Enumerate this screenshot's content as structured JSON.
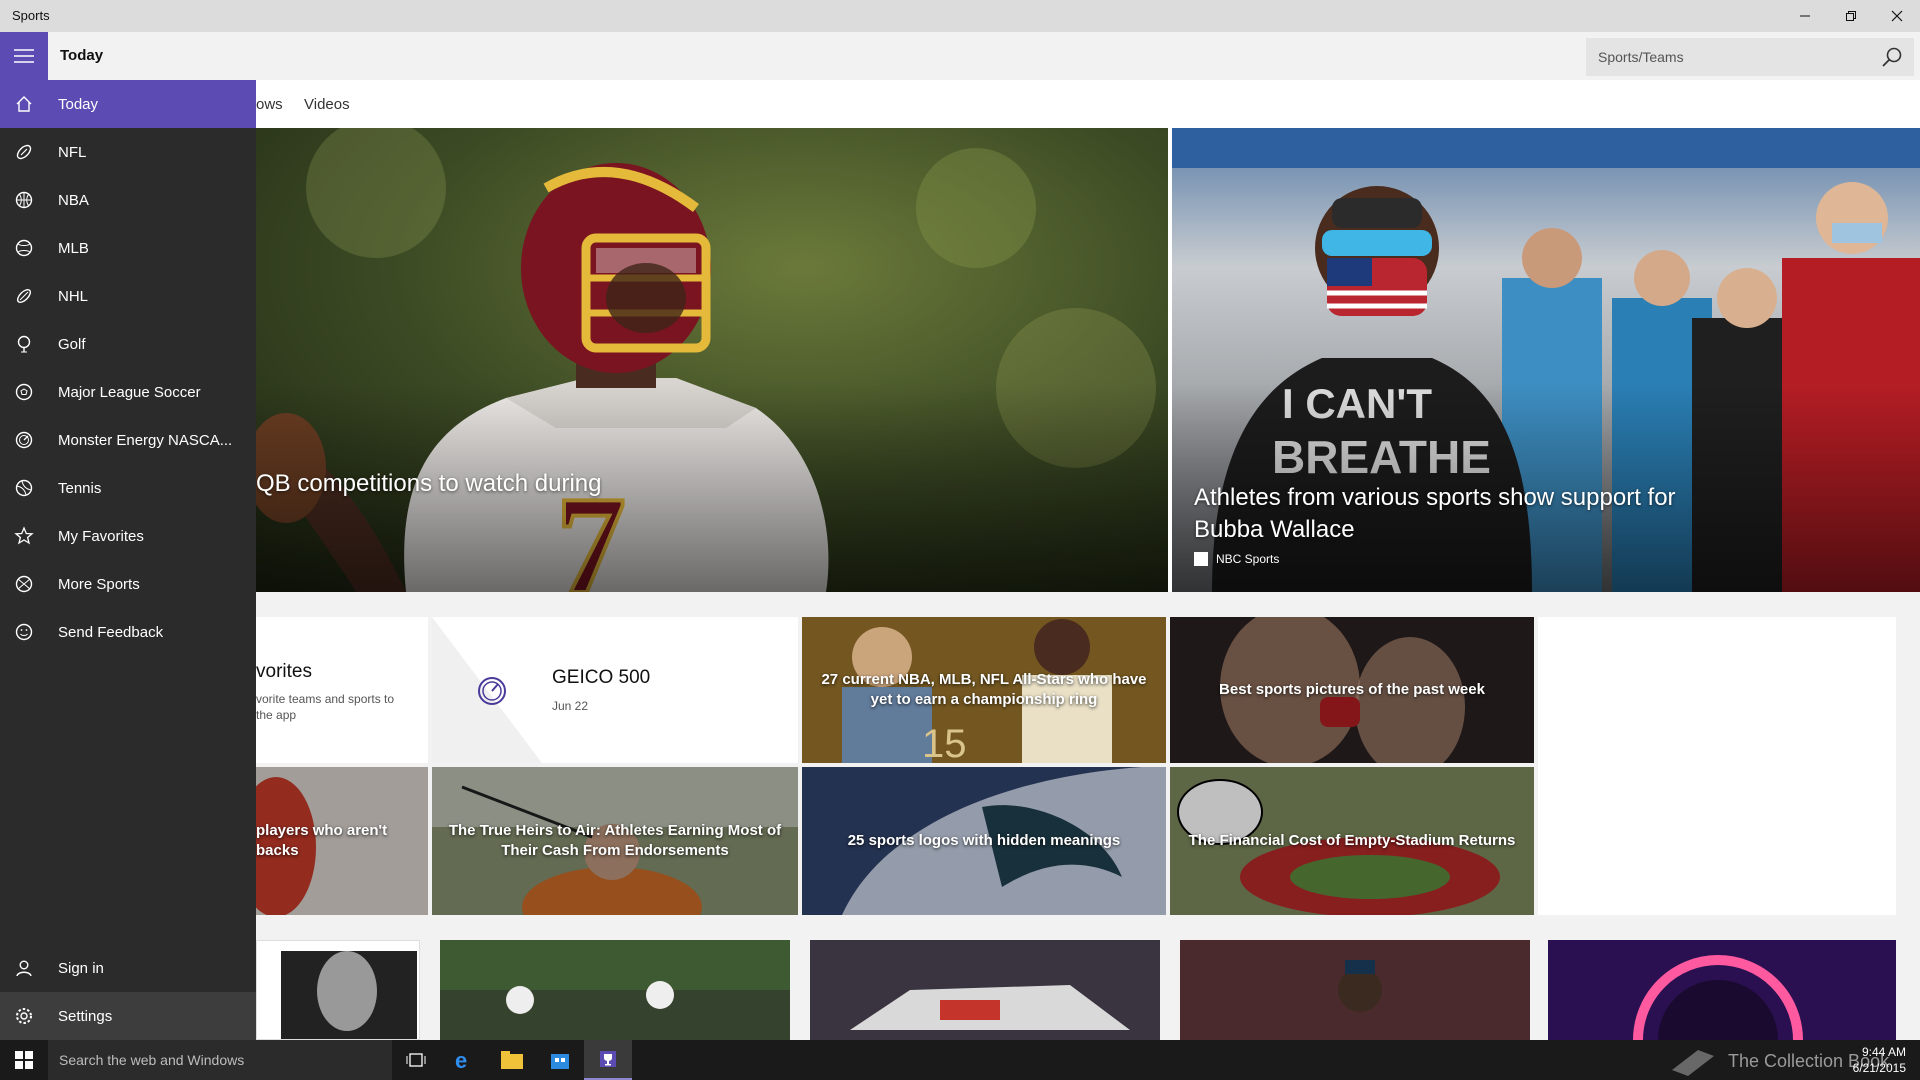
{
  "window": {
    "title": "Sports"
  },
  "header": {
    "page_title": "Today",
    "search_placeholder": "Sports/Teams"
  },
  "tabs": [
    {
      "label": "ows"
    },
    {
      "label": "Videos"
    }
  ],
  "hero": [
    {
      "headline": "QB competitions to watch during"
    },
    {
      "headline": "Athletes from various sports show support for Bubba Wallace",
      "source": "NBC Sports"
    }
  ],
  "favorites_card": {
    "title": "vorites",
    "line1": "vorite teams and sports to",
    "line2": "the app"
  },
  "event_card": {
    "title": "GEICO 500",
    "date": "Jun 22"
  },
  "tiles": [
    {
      "caption": "27 current NBA, MLB, NFL All-Stars who have yet to earn a championship ring"
    },
    {
      "caption": "Best sports pictures of the past week"
    },
    {
      "caption": "players who aren't backs"
    },
    {
      "caption": "The True Heirs to Air: Athletes Earning Most of Their Cash From Endorsements"
    },
    {
      "caption": "25 sports logos with hidden meanings"
    },
    {
      "caption": "The Financial Cost of Empty-Stadium Returns"
    }
  ],
  "sidebar": {
    "items": [
      {
        "label": "Today",
        "icon": "home-icon"
      },
      {
        "label": "NFL",
        "icon": "football-icon"
      },
      {
        "label": "NBA",
        "icon": "basketball-icon"
      },
      {
        "label": "MLB",
        "icon": "baseball-icon"
      },
      {
        "label": "NHL",
        "icon": "hockey-icon"
      },
      {
        "label": "Golf",
        "icon": "golf-icon"
      },
      {
        "label": "Major League Soccer",
        "icon": "soccer-icon"
      },
      {
        "label": "Monster Energy NASCA...",
        "icon": "nascar-icon"
      },
      {
        "label": "Tennis",
        "icon": "tennis-icon"
      },
      {
        "label": "My Favorites",
        "icon": "star-icon"
      },
      {
        "label": "More Sports",
        "icon": "more-sports-icon"
      },
      {
        "label": "Send Feedback",
        "icon": "smiley-icon"
      }
    ],
    "bottom": [
      {
        "label": "Sign in",
        "icon": "person-icon"
      },
      {
        "label": "Settings",
        "icon": "gear-icon"
      }
    ]
  },
  "taskbar": {
    "search_placeholder": "Search the web and Windows",
    "time": "9:44 AM",
    "date": "6/21/2015",
    "watermark": "The Collection Book"
  },
  "colors": {
    "accent": "#5b4bb2",
    "sidebar": "#2b2b2b",
    "taskbar": "#1a1a1a"
  }
}
